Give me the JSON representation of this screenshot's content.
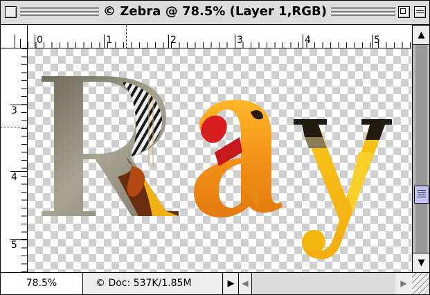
{
  "window": {
    "title": "© Zebra @ 78.5% (Layer 1,RGB)"
  },
  "rulers": {
    "horizontal": [
      "0",
      "1",
      "2",
      "3",
      "4",
      "5"
    ],
    "vertical": [
      "3",
      "4",
      "5"
    ]
  },
  "canvas": {
    "text": "Ray",
    "letter_colors": {
      "R": "#8a8676",
      "a": "#f4a020",
      "y": "#f6c21c",
      "dark": "#241b10",
      "red": "#d81e1e"
    }
  },
  "statusbar": {
    "zoom": "78.5%",
    "doc_info": "© Doc: 537K/1.85M",
    "popup_arrow": "▶"
  },
  "icons": {
    "close_box": "close-box-icon",
    "zoom_box": "zoom-box-icon",
    "collapse_box": "collapse-box-icon",
    "scroll_up": "▲",
    "scroll_down": "▼",
    "scroll_left": "◀",
    "scroll_right": "▶"
  }
}
